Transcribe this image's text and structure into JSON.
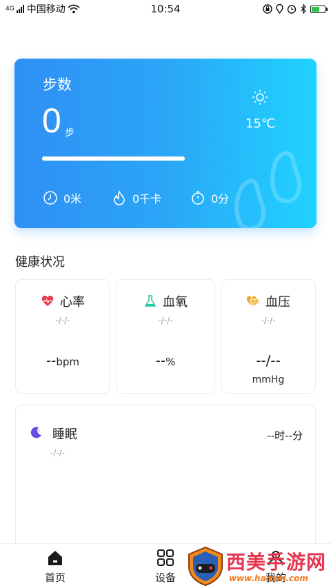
{
  "status_bar": {
    "network": "4G",
    "carrier": "中国移动",
    "time": "10:54"
  },
  "step_card": {
    "title": "步数",
    "steps": "0",
    "steps_unit": "步",
    "progress": 1.0,
    "temperature": "15℃",
    "distance": "0米",
    "calories": "0千卡",
    "duration": "0分"
  },
  "health": {
    "section_title": "健康状况",
    "heart_rate": {
      "label": "心率",
      "date": "-/-/-",
      "value": "--",
      "unit": "bpm"
    },
    "blood_oxygen": {
      "label": "血氧",
      "date": "-/-/-",
      "value": "--",
      "unit": "%"
    },
    "blood_pressure": {
      "label": "血压",
      "date": "-/-/-",
      "value": "--/--",
      "unit": "mmHg"
    },
    "sleep": {
      "label": "睡眠",
      "date": "-/-/-",
      "value": "--时--分"
    }
  },
  "bottom_nav": {
    "home": "首页",
    "devices": "设备",
    "mine": "我的"
  },
  "watermark": {
    "title": "西美手游网",
    "url": "www.hanxm.com"
  },
  "colors": {
    "card_gradient_start": "#2f8ff4",
    "card_gradient_end": "#1fd3ff",
    "heart": "#e83c4a",
    "oxygen": "#2bc9a2",
    "pressure": "#f5a623",
    "sleep": "#6a4de0"
  }
}
